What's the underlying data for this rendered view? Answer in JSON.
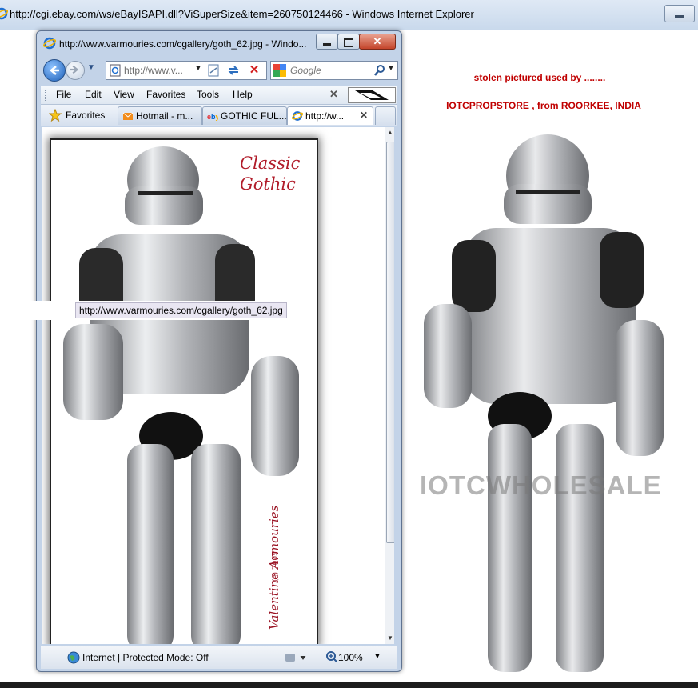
{
  "outer_window": {
    "title": "http://cgi.ebay.com/ws/eBayISAPI.dll?ViSuperSize&item=260750124466 - Windows Internet Explorer"
  },
  "right_panel": {
    "stolen_text": "stolen pictured used by ........",
    "seller_text": "IOTCPROPSTORE , from ROORKEE, INDIA",
    "watermark": "IOTCWHOLESALE"
  },
  "inner_window": {
    "title": "http://www.varmouries.com/cgallery/goth_62.jpg - Windo...",
    "address": "http://www.v...",
    "search_placeholder": "Google",
    "menu": [
      "File",
      "Edit",
      "View",
      "Favorites",
      "Tools",
      "Help"
    ],
    "favorites_label": "Favorites",
    "tabs": [
      {
        "label": "Hotmail - m...",
        "icon": "hotmail-icon"
      },
      {
        "label": "GOTHIC FUL...",
        "icon": "ebay-icon"
      },
      {
        "label": "http://w...",
        "icon": "ie-icon",
        "active": true
      }
    ],
    "tooltip": "http://www.varmouries.com/cgallery/goth_62.jpg",
    "image_text": {
      "classic_line1": "Classic",
      "classic_line2": "Gothic",
      "signature": "Valentine Armouries",
      "year": "(c) 2005"
    },
    "status_text": "Internet | Protected Mode: Off",
    "zoom": "100%"
  },
  "colors": {
    "accent_red": "#c00000",
    "window_frame": "#c3d3e8"
  }
}
